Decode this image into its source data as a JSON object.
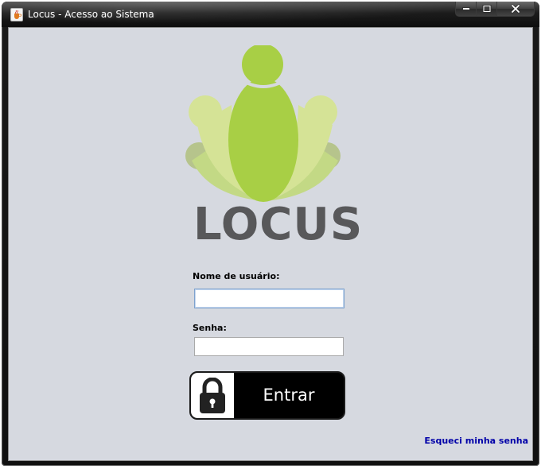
{
  "window": {
    "title": "Locus - Acesso ao Sistema",
    "app_icon": "java-cup-icon",
    "caption_buttons": [
      "minimize-icon",
      "maximize-icon",
      "close-icon"
    ]
  },
  "logo": {
    "brand_text": "LOCUS",
    "colors": {
      "center_green": "#a8cf45",
      "light_green": "#d5e396",
      "mid_green": "#c3d985",
      "muted_green": "#b6c48c",
      "text_gray": "#58585a"
    }
  },
  "form": {
    "username_label": "Nome de usuário:",
    "username_value": "",
    "password_label": "Senha:",
    "password_value": "",
    "login_button_label": "Entrar",
    "login_button_icon": "padlock-icon",
    "forgot_password_link": "Esqueci minha senha"
  },
  "colors": {
    "background": "#d6d9e0",
    "link": "#0000a8",
    "button_bg": "#000000"
  }
}
